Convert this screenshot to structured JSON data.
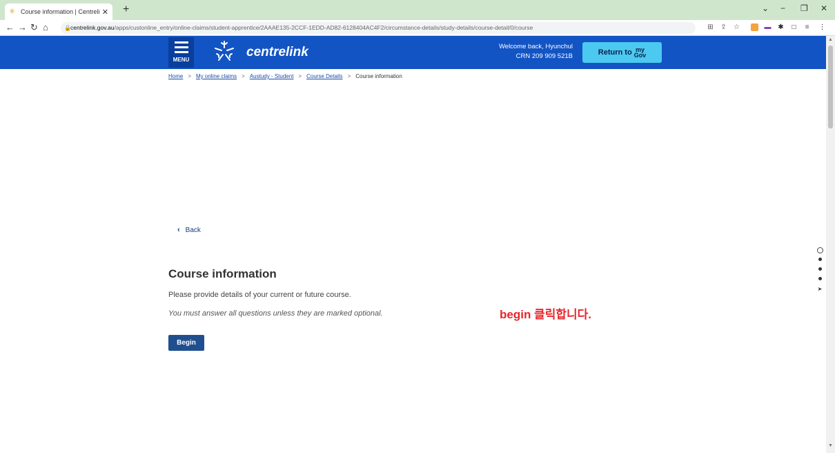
{
  "browser": {
    "tab_title": "Course information | Centrelink",
    "tab_close": "✕",
    "new_tab": "+",
    "url_host": "centrelink.gov.au",
    "url_path": "/apps/custonline_entry/online-claims/student-apprentice/2AAAE135-2CCF-1EDD-AD82-6128404AC4F2/circumstance-details/study-details/course-detail/0/course",
    "window_controls": [
      "⌄",
      "−",
      "❐",
      "✕"
    ]
  },
  "header": {
    "menu_label": "MENU",
    "logo_text": "centrelink",
    "welcome_line1": "Welcome back, Hyunchul",
    "welcome_line2": "CRN 209 909 521B",
    "return_label": "Return to",
    "mygov_top": "my",
    "mygov_bottom": "Gov"
  },
  "breadcrumb": {
    "items": [
      "Home",
      "My online claims",
      "Austudy - Student",
      "Course Details"
    ],
    "current": "Course information",
    "separator": ">"
  },
  "main": {
    "back_label": "Back",
    "title": "Course information",
    "intro": "Please provide details of your current or future course.",
    "note": "You must answer all questions unless they are marked optional.",
    "begin_label": "Begin"
  },
  "annotation": {
    "text": "begin 클릭합니다."
  },
  "colors": {
    "header_blue": "#1254c4",
    "menu_blue": "#0a3f9e",
    "button_blue": "#1f4f8e",
    "return_cyan": "#4cc9f0",
    "annotation_red": "#e8242b"
  },
  "icons": {
    "favicon": "centrelink-star-icon",
    "lock": "lock-icon",
    "back": "chevron-left-icon"
  }
}
